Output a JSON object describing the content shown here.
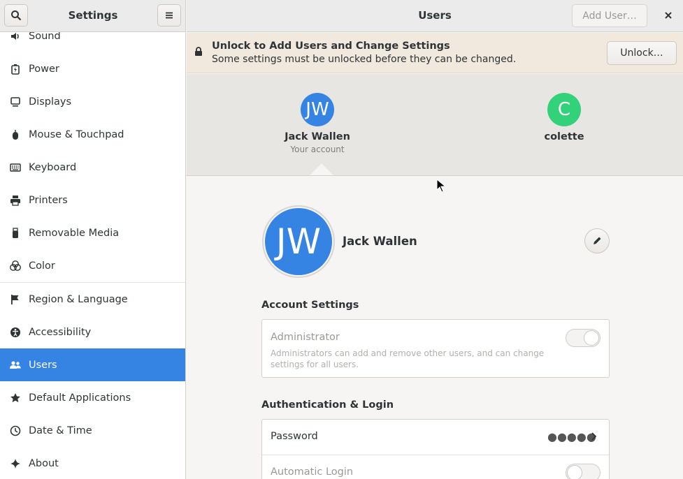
{
  "sidebar": {
    "title": "Settings",
    "items": [
      {
        "label": "Sound",
        "icon": "speaker-icon"
      },
      {
        "label": "Power",
        "icon": "battery-icon"
      },
      {
        "label": "Displays",
        "icon": "monitor-icon"
      },
      {
        "label": "Mouse & Touchpad",
        "icon": "mouse-icon"
      },
      {
        "label": "Keyboard",
        "icon": "keyboard-icon"
      },
      {
        "label": "Printers",
        "icon": "printer-icon"
      },
      {
        "label": "Removable Media",
        "icon": "usb-drive-icon"
      },
      {
        "label": "Color",
        "icon": "color-icon"
      },
      {
        "label": "Region & Language",
        "icon": "flag-icon"
      },
      {
        "label": "Accessibility",
        "icon": "accessibility-icon"
      },
      {
        "label": "Users",
        "icon": "users-icon"
      },
      {
        "label": "Default Applications",
        "icon": "star-icon"
      },
      {
        "label": "Date & Time",
        "icon": "clock-icon"
      },
      {
        "label": "About",
        "icon": "sparkle-icon"
      }
    ],
    "active": "Users"
  },
  "header": {
    "title": "Users",
    "add_user_label": "Add User…"
  },
  "banner": {
    "title": "Unlock to Add Users and Change Settings",
    "subtitle": "Some settings must be unlocked before they can be changed.",
    "unlock_label": "Unlock…"
  },
  "carousel": {
    "users": [
      {
        "initials": "JW",
        "name": "Jack Wallen",
        "subtitle": "Your account",
        "color": "#3584e4"
      },
      {
        "initials": "C",
        "name": "colette",
        "subtitle": "",
        "color": "#33d17a"
      }
    ]
  },
  "profile": {
    "initials": "JW",
    "name": "Jack Wallen",
    "avatar_color": "#3584e4"
  },
  "account_settings": {
    "title": "Account Settings",
    "administrator_label": "Administrator",
    "administrator_desc": "Administrators can add and remove other users, and can change settings for all users.",
    "administrator_enabled": false
  },
  "auth": {
    "title": "Authentication & Login",
    "password_label": "Password",
    "password_value": "●●●●●",
    "auto_login_label": "Automatic Login",
    "auto_login_enabled": false
  },
  "colors": {
    "accent": "#3584e4",
    "banner": "#f1e8de"
  }
}
